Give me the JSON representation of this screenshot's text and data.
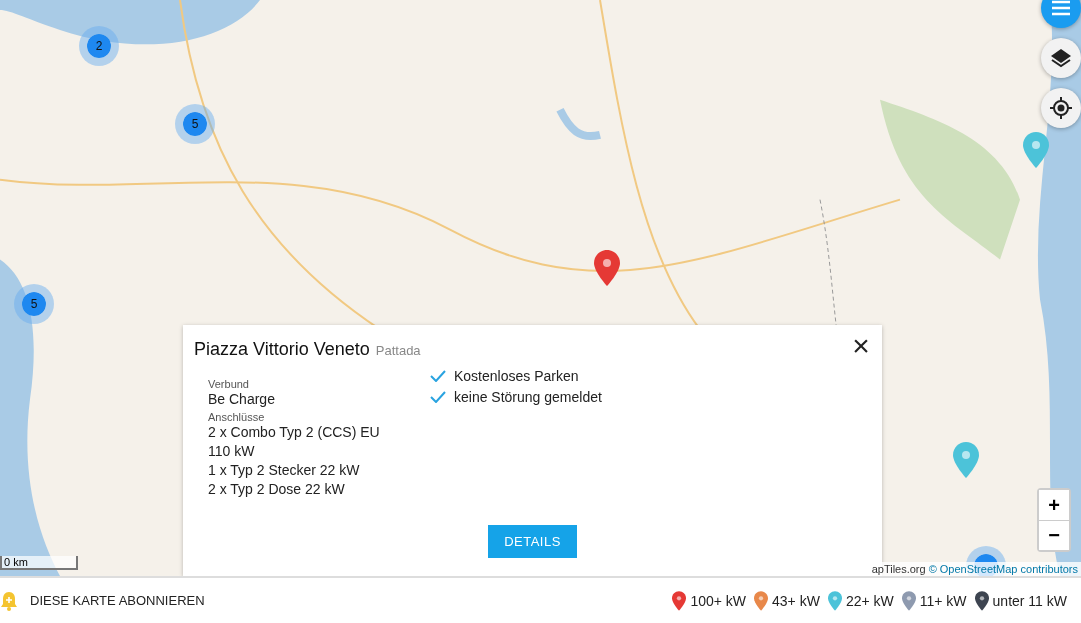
{
  "map": {
    "controls": [
      {
        "kind": "menu",
        "selected": true
      },
      {
        "kind": "layers",
        "selected": false
      },
      {
        "kind": "locate",
        "selected": false
      }
    ],
    "markers": [
      {
        "kind": "cluster",
        "count": "2"
      },
      {
        "kind": "cluster",
        "count": "5"
      },
      {
        "kind": "cluster",
        "count": "5"
      },
      {
        "kind": "pin",
        "color": "#e53935"
      },
      {
        "kind": "pin",
        "color": "#4cc3d9"
      },
      {
        "kind": "pin",
        "color": "#4cc3d9"
      },
      {
        "kind": "cluster"
      }
    ],
    "zoom": {
      "in": "+",
      "out": "−"
    },
    "scale": "0 km",
    "attribution": {
      "text": "apTiles.org",
      "link": "© OpenStreetMap contributors"
    }
  },
  "popup": {
    "title": "Piazza Vittorio Veneto",
    "place": "Pattada",
    "close": "×",
    "fields": [
      {
        "label": "Verbund",
        "lines": [
          "Be Charge"
        ]
      },
      {
        "label": "Anschlüsse",
        "lines": [
          "2 x Combo Typ 2 (CCS) EU",
          "110 kW",
          "1 x Typ 2 Stecker 22 kW",
          "2 x Typ 2 Dose 22 kW"
        ]
      }
    ],
    "features": [
      "Kostenloses Parken",
      "keine Störung gemeldet"
    ],
    "button": "DETAILS"
  },
  "footer": {
    "subscribe": "DIESE KARTE ABONNIEREN",
    "legend": [
      {
        "label": "100+ kW",
        "color": "#e53935"
      },
      {
        "label": "43+ kW",
        "color": "#e8884a"
      },
      {
        "label": "22+ kW",
        "color": "#4cc3d9"
      },
      {
        "label": "11+ kW",
        "color": "#8e9aaf"
      },
      {
        "label": "unter 11 kW",
        "color": "#3d4450"
      }
    ]
  }
}
